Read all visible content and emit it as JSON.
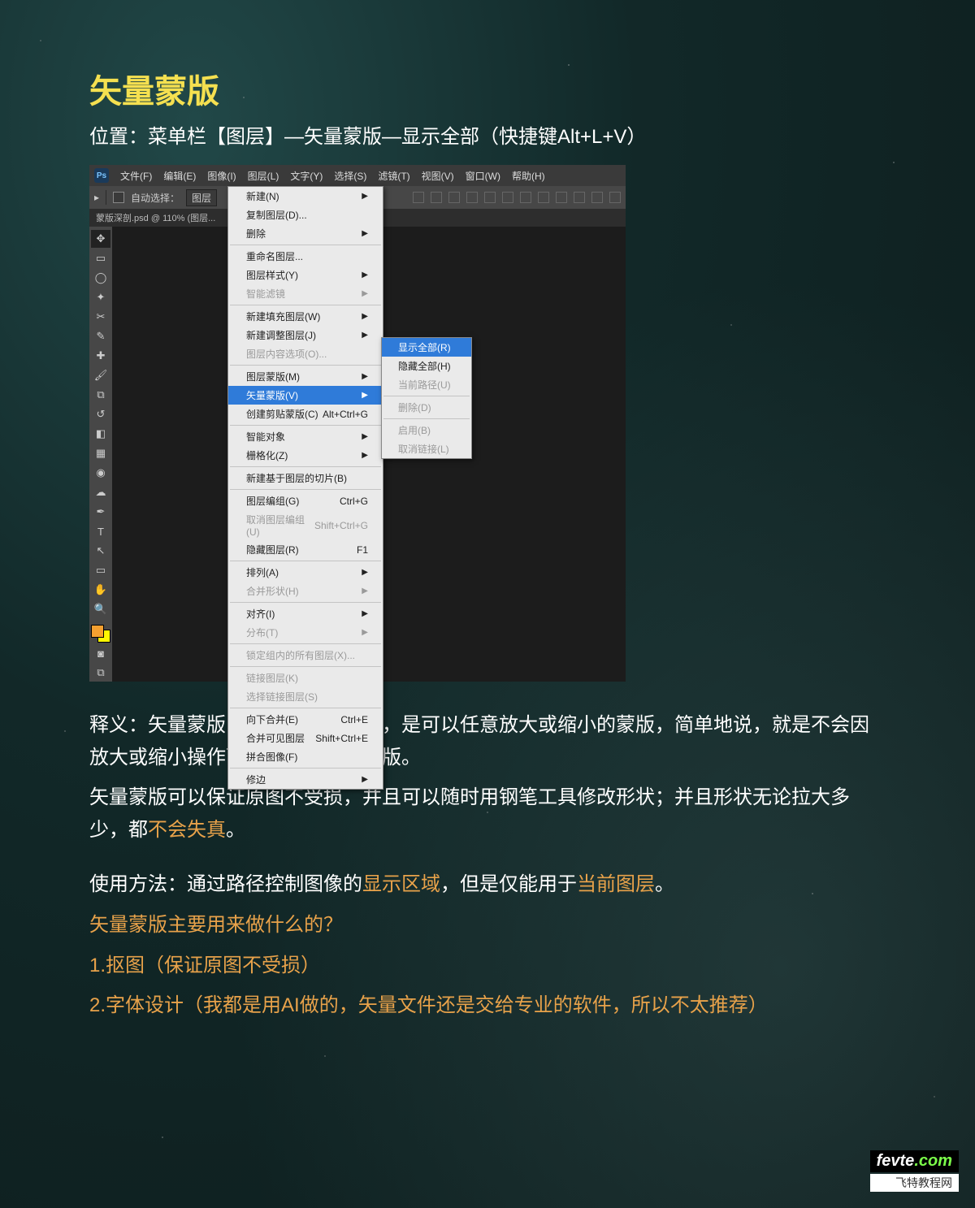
{
  "heading": "矢量蒙版",
  "location": "位置：菜单栏【图层】—矢量蒙版—显示全部（快捷键Alt+L+V）",
  "ps": {
    "logo": "Ps",
    "menubar": [
      "文件(F)",
      "编辑(E)",
      "图像(I)",
      "图层(L)",
      "文字(Y)",
      "选择(S)",
      "滤镜(T)",
      "视图(V)",
      "窗口(W)",
      "帮助(H)"
    ],
    "options": {
      "autoSelect": "自动选择：",
      "layer": "图层",
      "cursor": "▸"
    },
    "tab": "蒙版深剖.psd @ 110% (图层...",
    "menu": [
      {
        "label": "新建(N)",
        "arrow": true
      },
      {
        "label": "复制图层(D)..."
      },
      {
        "label": "删除",
        "arrow": true
      },
      {
        "sep": true
      },
      {
        "label": "重命名图层..."
      },
      {
        "label": "图层样式(Y)",
        "arrow": true
      },
      {
        "label": "智能滤镜",
        "disabled": true,
        "arrow": true
      },
      {
        "sep": true
      },
      {
        "label": "新建填充图层(W)",
        "arrow": true
      },
      {
        "label": "新建调整图层(J)",
        "arrow": true
      },
      {
        "label": "图层内容选项(O)...",
        "disabled": true
      },
      {
        "sep": true
      },
      {
        "label": "图层蒙版(M)",
        "arrow": true
      },
      {
        "label": "矢量蒙版(V)",
        "arrow": true,
        "hover": true
      },
      {
        "label": "创建剪贴蒙版(C)",
        "shortcut": "Alt+Ctrl+G"
      },
      {
        "sep": true
      },
      {
        "label": "智能对象",
        "arrow": true
      },
      {
        "label": "栅格化(Z)",
        "arrow": true
      },
      {
        "sep": true
      },
      {
        "label": "新建基于图层的切片(B)"
      },
      {
        "sep": true
      },
      {
        "label": "图层编组(G)",
        "shortcut": "Ctrl+G"
      },
      {
        "label": "取消图层编组(U)",
        "shortcut": "Shift+Ctrl+G",
        "disabled": true
      },
      {
        "label": "隐藏图层(R)",
        "shortcut": "F1"
      },
      {
        "sep": true
      },
      {
        "label": "排列(A)",
        "arrow": true
      },
      {
        "label": "合并形状(H)",
        "disabled": true,
        "arrow": true
      },
      {
        "sep": true
      },
      {
        "label": "对齐(I)",
        "arrow": true
      },
      {
        "label": "分布(T)",
        "disabled": true,
        "arrow": true
      },
      {
        "sep": true
      },
      {
        "label": "锁定组内的所有图层(X)...",
        "disabled": true
      },
      {
        "sep": true
      },
      {
        "label": "链接图层(K)",
        "disabled": true
      },
      {
        "label": "选择链接图层(S)",
        "disabled": true
      },
      {
        "sep": true
      },
      {
        "label": "向下合并(E)",
        "shortcut": "Ctrl+E"
      },
      {
        "label": "合并可见图层",
        "shortcut": "Shift+Ctrl+E"
      },
      {
        "label": "拼合图像(F)"
      },
      {
        "sep": true
      },
      {
        "label": "修边",
        "arrow": true
      }
    ],
    "submenu": [
      {
        "label": "显示全部(R)",
        "hover": true
      },
      {
        "label": "隐藏全部(H)"
      },
      {
        "label": "当前路径(U)",
        "disabled": true
      },
      {
        "sep": true
      },
      {
        "label": "删除(D)",
        "disabled": true
      },
      {
        "sep": true
      },
      {
        "label": "启用(B)",
        "disabled": true
      },
      {
        "label": "取消链接(L)",
        "disabled": true
      }
    ]
  },
  "article": {
    "p1a": "释义：矢量蒙版，也叫做路径蒙版，是可以任意放大或缩小的蒙版，简单地说，就是不会因放大或缩小操作而影响清晰度的蒙版。",
    "p2a": "矢量蒙版可以保证原图不受损，并且可以随时用钢笔工具修改形状；并且形状无论拉大多少，都",
    "p2hl": "不会失真",
    "p2b": "。",
    "p3a": "使用方法：通过路径控制图像的",
    "p3hl1": "显示区域",
    "p3b": "，但是仅能用于",
    "p3hl2": "当前图层",
    "p3c": "。",
    "q": "矢量蒙版主要用来做什么的？",
    "a1": "1.抠图（保证原图不受损）",
    "a2": "2.字体设计（我都是用AI做的，矢量文件还是交给专业的软件，所以不太推荐）"
  },
  "watermark": {
    "line1a": "fevte",
    "line1b": ".com",
    "line2": "飞特教程网"
  }
}
